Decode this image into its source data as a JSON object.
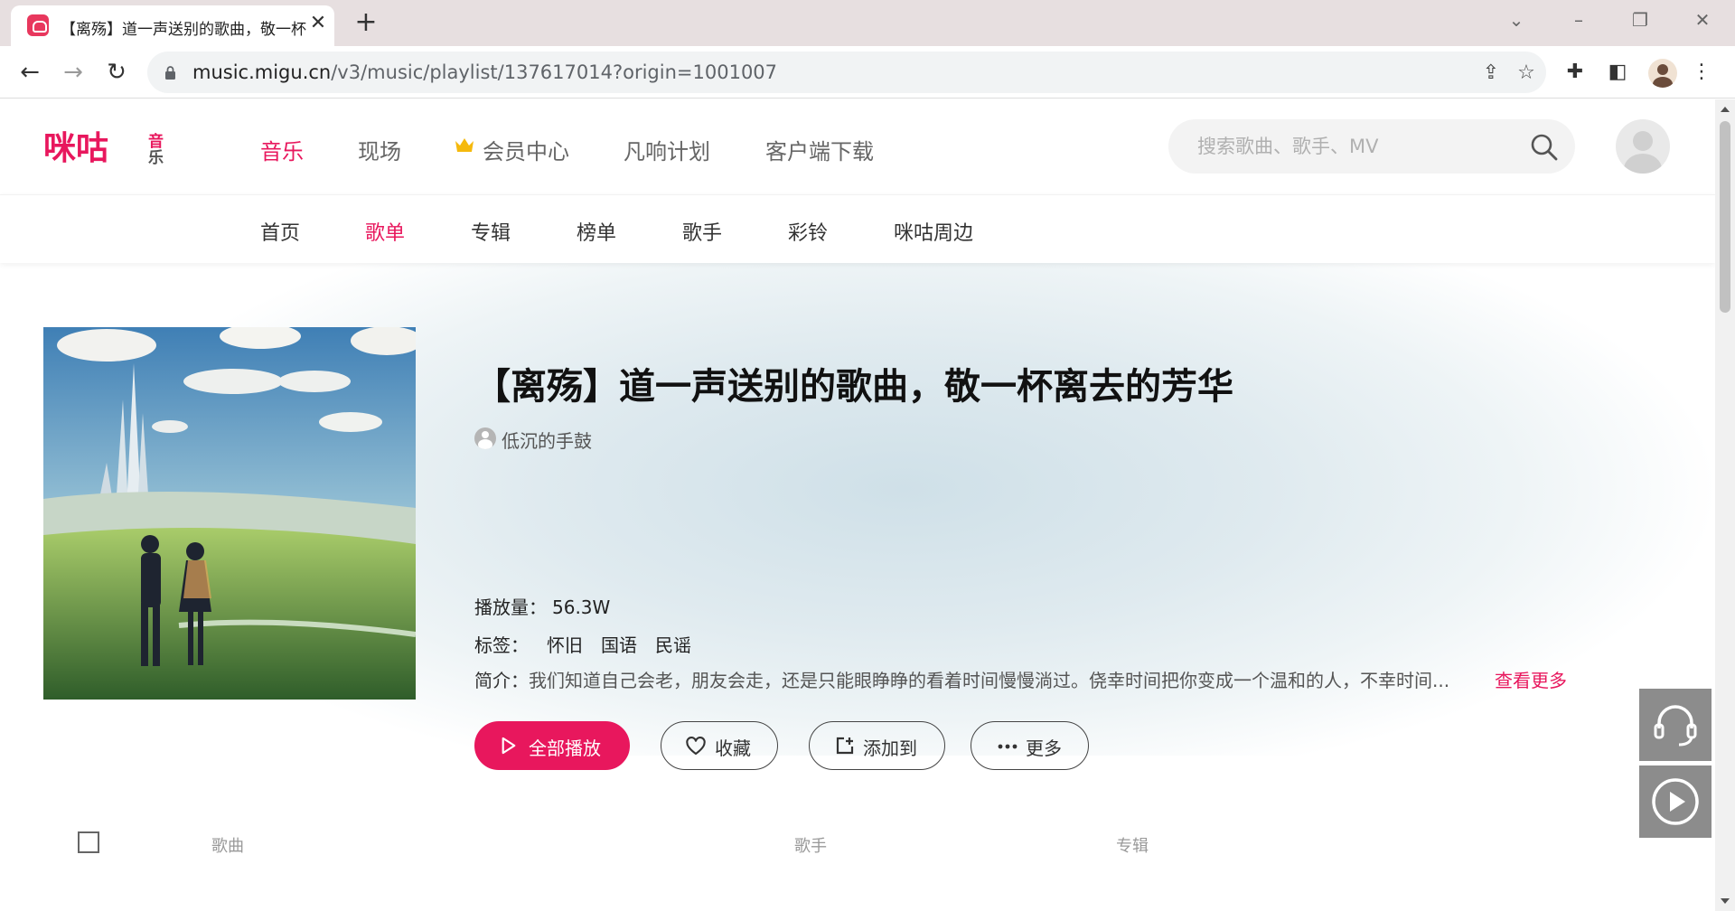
{
  "browser": {
    "tab_title": "【离殇】道一声送别的歌曲，敬一杯离去的芳华",
    "url_host": "music.migu.cn",
    "url_path": "/v3/music/playlist/137617014?origin=1001007"
  },
  "header": {
    "logo_text": "咪咕",
    "logo_sub": "音乐",
    "nav": [
      {
        "label": "音乐",
        "active": true
      },
      {
        "label": "现场"
      },
      {
        "label": "会员中心"
      },
      {
        "label": "凡响计划"
      },
      {
        "label": "客户端下载"
      }
    ],
    "search_placeholder": "搜索歌曲、歌手、MV"
  },
  "subnav": [
    {
      "label": "首页"
    },
    {
      "label": "歌单",
      "active": true
    },
    {
      "label": "专辑"
    },
    {
      "label": "榜单"
    },
    {
      "label": "歌手"
    },
    {
      "label": "彩铃"
    },
    {
      "label": "咪咕周边"
    }
  ],
  "playlist": {
    "title": "【离殇】道一声送别的歌曲，敬一杯离去的芳华",
    "author": "低沉的手鼓",
    "plays_label": "播放量：",
    "plays": "56.3W",
    "tags_label": "标签：",
    "tags": [
      "怀旧",
      "国语",
      "民谣"
    ],
    "intro_label": "简介：",
    "intro": "我们知道自己会老，朋友会走，还是只能眼睁睁的看着时间慢慢淌过。侥幸时间把你变成一个温和的人，不幸时间...",
    "more_link": "查看更多"
  },
  "actions": {
    "play_all": "全部播放",
    "favorite": "收藏",
    "add_to": "添加到",
    "more": "更多"
  },
  "list_header": {
    "song": "歌曲",
    "singer": "歌手",
    "album": "专辑"
  },
  "colors": {
    "accent": "#e8175d",
    "float_button": "#8c8c8c"
  }
}
